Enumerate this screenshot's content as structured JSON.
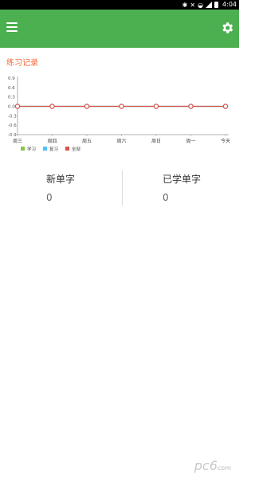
{
  "status_bar": {
    "time": "4:04"
  },
  "section": {
    "title": "练习记录"
  },
  "chart_data": {
    "type": "line",
    "categories": [
      "周三",
      "周四",
      "周五",
      "周六",
      "周日",
      "周一",
      "今天"
    ],
    "y_ticks": [
      "0.9",
      "0.6",
      "0.3",
      "0.0",
      "-0.3",
      "-0.6",
      "-0.9"
    ],
    "ylim": [
      -0.9,
      0.9
    ],
    "series": [
      {
        "name": "学习",
        "color": "#8bc34a",
        "values": [
          0,
          0,
          0,
          0,
          0,
          0,
          0
        ]
      },
      {
        "name": "复习",
        "color": "#4fc3f7",
        "values": [
          0,
          0,
          0,
          0,
          0,
          0,
          0
        ]
      },
      {
        "name": "全部",
        "color": "#d9534f",
        "values": [
          0,
          0,
          0,
          0,
          0,
          0,
          0
        ]
      }
    ],
    "legend_position": "bottom-left"
  },
  "stats": {
    "new_words": {
      "label": "新单字",
      "value": "0"
    },
    "learned_words": {
      "label": "已学单字",
      "value": "0"
    }
  },
  "watermark": {
    "text": "pc6",
    "sub": "com"
  }
}
